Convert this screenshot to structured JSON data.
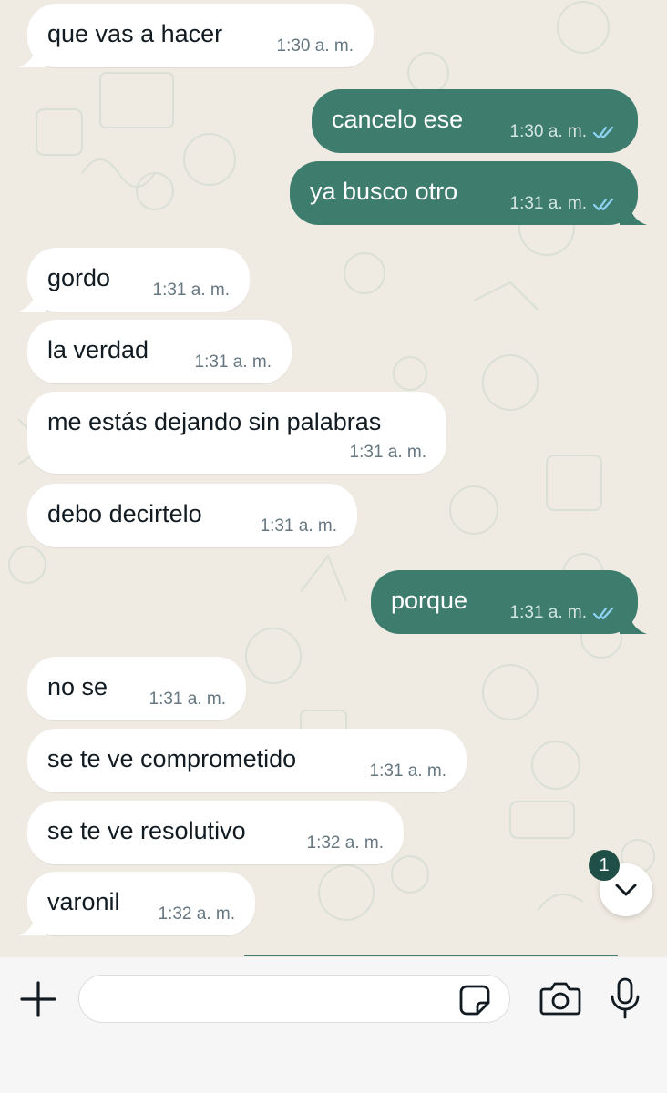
{
  "messages": [
    {
      "direction": "in",
      "text": "que vas a hacer",
      "time": "1:30 a. m."
    },
    {
      "direction": "out",
      "text": "cancelo ese",
      "time": "1:30 a. m.",
      "status": "read"
    },
    {
      "direction": "out",
      "text": "ya busco otro",
      "time": "1:31 a. m.",
      "status": "read"
    },
    {
      "direction": "in",
      "text": "gordo",
      "time": "1:31 a. m."
    },
    {
      "direction": "in",
      "text": "la verdad",
      "time": "1:31 a. m."
    },
    {
      "direction": "in",
      "text": "me estás dejando sin palabras",
      "time": "1:31 a. m."
    },
    {
      "direction": "in",
      "text": "debo decirtelo",
      "time": "1:31 a. m."
    },
    {
      "direction": "out",
      "text": "porque",
      "time": "1:31 a. m.",
      "status": "read"
    },
    {
      "direction": "in",
      "text": "no se",
      "time": "1:31 a. m."
    },
    {
      "direction": "in",
      "text": "se te ve comprometido",
      "time": "1:31 a. m."
    },
    {
      "direction": "in",
      "text": "se te ve resolutivo",
      "time": "1:32 a. m."
    },
    {
      "direction": "in",
      "text": "varonil",
      "time": "1:32 a. m."
    }
  ],
  "scroll_to_bottom": {
    "unread_count": "1",
    "icon": "chevron-down-icon"
  },
  "input_bar": {
    "placeholder": "",
    "icons": [
      "plus-icon",
      "sticker-icon",
      "camera-icon",
      "microphone-icon"
    ]
  },
  "colors": {
    "outgoing_bubble": "#3e7c6e",
    "incoming_bubble": "#ffffff",
    "chat_background": "#efeae2",
    "read_ticks": "#8fd3f5",
    "badge": "#1f4f46"
  }
}
